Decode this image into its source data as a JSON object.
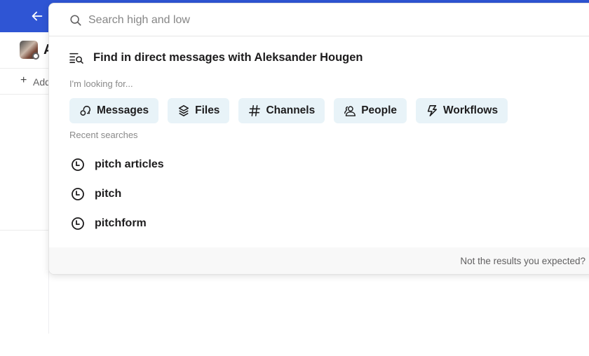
{
  "topbar": {
    "back_icon": "arrow-left-icon",
    "color": "#2f55d4"
  },
  "dm": {
    "name_partial": "A",
    "add_label": "Add"
  },
  "search": {
    "placeholder": "Search high and low",
    "value": ""
  },
  "scope": {
    "label": "Find in direct messages with Aleksander Hougen",
    "icon": "filter-search-icon"
  },
  "looking_for": {
    "label": "I'm looking for...",
    "chips": [
      {
        "label": "Messages",
        "icon": "messages-icon"
      },
      {
        "label": "Files",
        "icon": "files-icon"
      },
      {
        "label": "Channels",
        "icon": "hash-icon"
      },
      {
        "label": "People",
        "icon": "people-icon"
      },
      {
        "label": "Workflows",
        "icon": "workflows-icon"
      }
    ]
  },
  "recent": {
    "label": "Recent searches",
    "items": [
      {
        "label": "pitch articles",
        "icon": "clock-icon"
      },
      {
        "label": "pitch",
        "icon": "clock-icon"
      },
      {
        "label": "pitchform",
        "icon": "clock-icon"
      }
    ]
  },
  "footer": {
    "text": "Not the results you expected?"
  },
  "colors": {
    "chip_bg": "#e8f3f8",
    "accent": "#2f55d4"
  }
}
